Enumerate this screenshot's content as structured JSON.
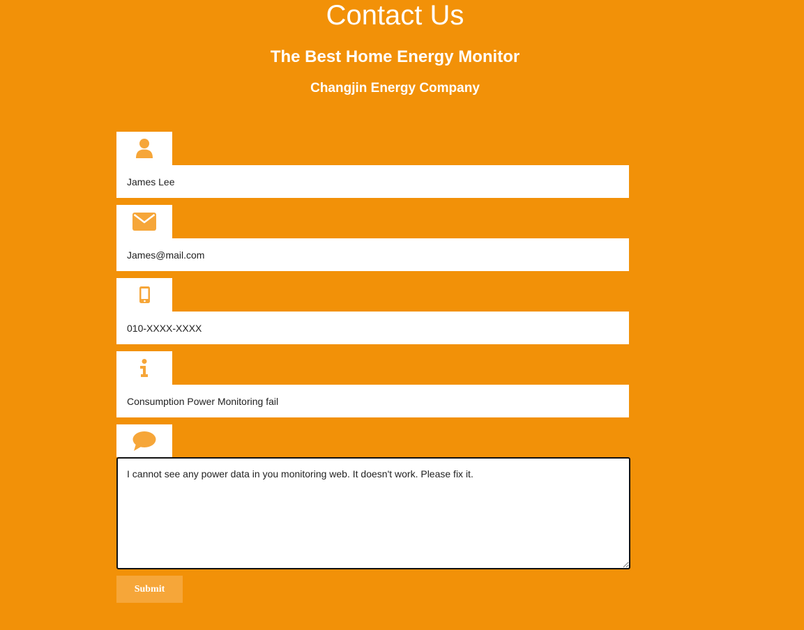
{
  "header": {
    "title": "Contact Us",
    "subtitle": "The Best Home Energy Monitor",
    "company": "Changjin Energy Company"
  },
  "form": {
    "name": {
      "icon": "user-icon",
      "value": "James Lee"
    },
    "email": {
      "icon": "envelope-icon",
      "value": "James@mail.com"
    },
    "phone": {
      "icon": "mobile-phone-icon",
      "value": "010-XXXX-XXXX"
    },
    "subject": {
      "icon": "info-icon",
      "value": "Consumption Power Monitoring fail"
    },
    "message": {
      "icon": "comment-icon",
      "value": "I cannot see any power data in you monitoring web. It doesn't work. Please fix it."
    },
    "submit_label": "Submit"
  },
  "colors": {
    "background": "#f29108",
    "icon": "#f6a639",
    "submit_button": "#f6a639",
    "text": "#ffffff"
  }
}
